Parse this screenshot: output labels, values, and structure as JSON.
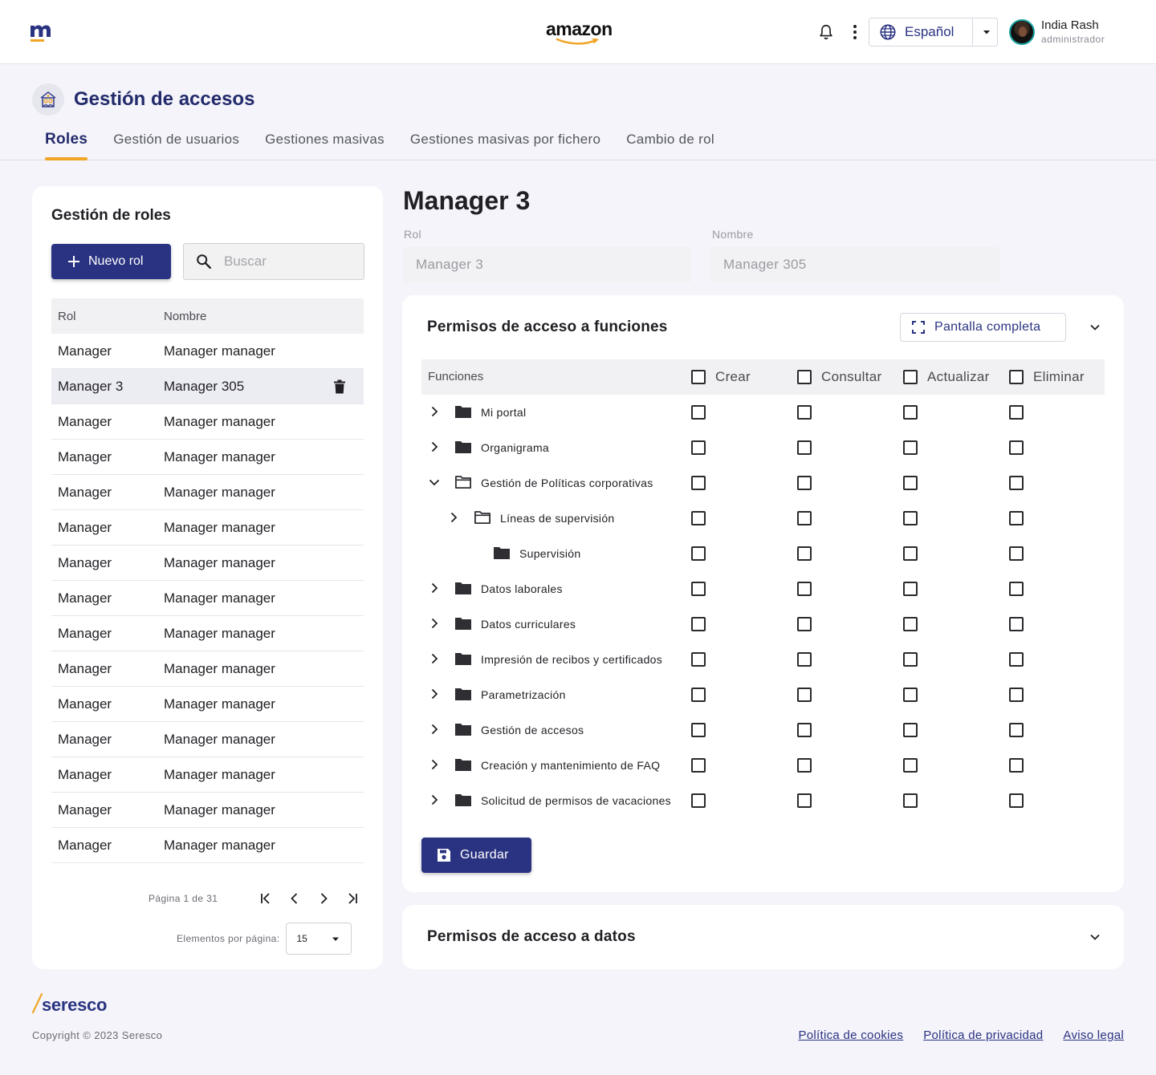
{
  "header": {
    "brand": "amazon",
    "language": "Español",
    "user": {
      "name": "India Rash",
      "role": "administrador"
    }
  },
  "page": {
    "title": "Gestión de accesos",
    "tabs": [
      {
        "label": "Roles",
        "active": true
      },
      {
        "label": "Gestión de usuarios"
      },
      {
        "label": "Gestiones masivas"
      },
      {
        "label": "Gestiones masivas por fichero"
      },
      {
        "label": "Cambio de rol"
      }
    ]
  },
  "roles": {
    "title": "Gestión de roles",
    "new_button": "Nuevo rol",
    "search_placeholder": "Buscar",
    "columns": [
      "Rol",
      "Nombre"
    ],
    "rows": [
      {
        "rol": "Manager",
        "nombre": "Manager manager"
      },
      {
        "rol": "Manager 3",
        "nombre": "Manager 305",
        "selected": true
      },
      {
        "rol": "Manager",
        "nombre": "Manager manager"
      },
      {
        "rol": "Manager",
        "nombre": "Manager manager"
      },
      {
        "rol": "Manager",
        "nombre": "Manager manager"
      },
      {
        "rol": "Manager",
        "nombre": "Manager manager"
      },
      {
        "rol": "Manager",
        "nombre": "Manager manager"
      },
      {
        "rol": "Manager",
        "nombre": "Manager manager"
      },
      {
        "rol": "Manager",
        "nombre": "Manager manager"
      },
      {
        "rol": "Manager",
        "nombre": "Manager manager"
      },
      {
        "rol": "Manager",
        "nombre": "Manager manager"
      },
      {
        "rol": "Manager",
        "nombre": "Manager manager"
      },
      {
        "rol": "Manager",
        "nombre": "Manager manager"
      },
      {
        "rol": "Manager",
        "nombre": "Manager manager"
      },
      {
        "rol": "Manager",
        "nombre": "Manager manager"
      }
    ],
    "pagination": {
      "label": "Página 1 de 31",
      "per_page_label": "Elementos por página:",
      "per_page_value": "15"
    }
  },
  "detail": {
    "title": "Manager 3",
    "rol_label": "Rol",
    "rol_value": "Manager 3",
    "nombre_label": "Nombre",
    "nombre_value": "Manager 305"
  },
  "permissions": {
    "title": "Permisos de acceso a funciones",
    "fullscreen_button": "Pantalla completa",
    "function_column": "Funciones",
    "columns": [
      "Crear",
      "Consultar",
      "Actualizar",
      "Eliminar"
    ],
    "rows": [
      {
        "label": "Mi portal",
        "level": 0,
        "expander": "right",
        "folder": "filled"
      },
      {
        "label": "Organigrama",
        "level": 0,
        "expander": "right",
        "folder": "filled"
      },
      {
        "label": "Gestión de Políticas corporativas",
        "level": 0,
        "expander": "down",
        "folder": "open"
      },
      {
        "label": "Líneas de supervisión",
        "level": 1,
        "expander": "right",
        "folder": "open"
      },
      {
        "label": "Supervisión",
        "level": 2,
        "expander": "none",
        "folder": "filled"
      },
      {
        "label": "Datos laborales",
        "level": 0,
        "expander": "right",
        "folder": "filled"
      },
      {
        "label": "Datos curriculares",
        "level": 0,
        "expander": "right",
        "folder": "filled"
      },
      {
        "label": "Impresión de recibos y certificados",
        "level": 0,
        "expander": "right",
        "folder": "filled"
      },
      {
        "label": "Parametrización",
        "level": 0,
        "expander": "right",
        "folder": "filled"
      },
      {
        "label": "Gestión de accesos",
        "level": 0,
        "expander": "right",
        "folder": "filled"
      },
      {
        "label": "Creación y mantenimiento de FAQ",
        "level": 0,
        "expander": "right",
        "folder": "filled"
      },
      {
        "label": "Solicitud de permisos de vacaciones",
        "level": 0,
        "expander": "right",
        "folder": "filled"
      }
    ],
    "save_button": "Guardar"
  },
  "data_permissions": {
    "title": "Permisos de acceso a datos"
  },
  "footer": {
    "logo": "seresco",
    "copyright": "Copyright © 2023 Seresco",
    "links": [
      "Política de cookies",
      "Política de privacidad",
      "Aviso legal"
    ]
  },
  "colors": {
    "primary": "#2a3381",
    "accent": "#f0a527",
    "background": "#f4f4fa"
  }
}
